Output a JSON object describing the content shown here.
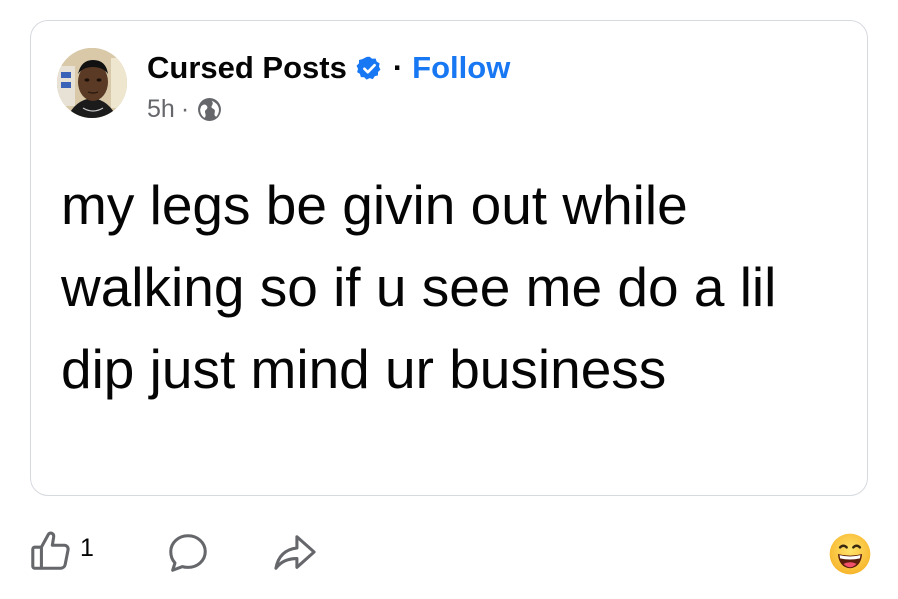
{
  "post": {
    "author_name": "Cursed Posts",
    "separator": "·",
    "follow_label": "Follow",
    "timestamp": "5h",
    "meta_separator": "·",
    "privacy_icon": "globe-icon",
    "text": "my legs be givin out while walking so if u see me do a lil dip just mind ur business"
  },
  "actions": {
    "like_icon": "thumbs-up-icon",
    "like_count": "1",
    "comment_icon": "comment-icon",
    "share_icon": "share-icon",
    "reaction_icon": "grinning-emoji-icon"
  },
  "colors": {
    "accent": "#1877f2",
    "secondary_text": "#65676b",
    "border": "#d6d9de"
  }
}
